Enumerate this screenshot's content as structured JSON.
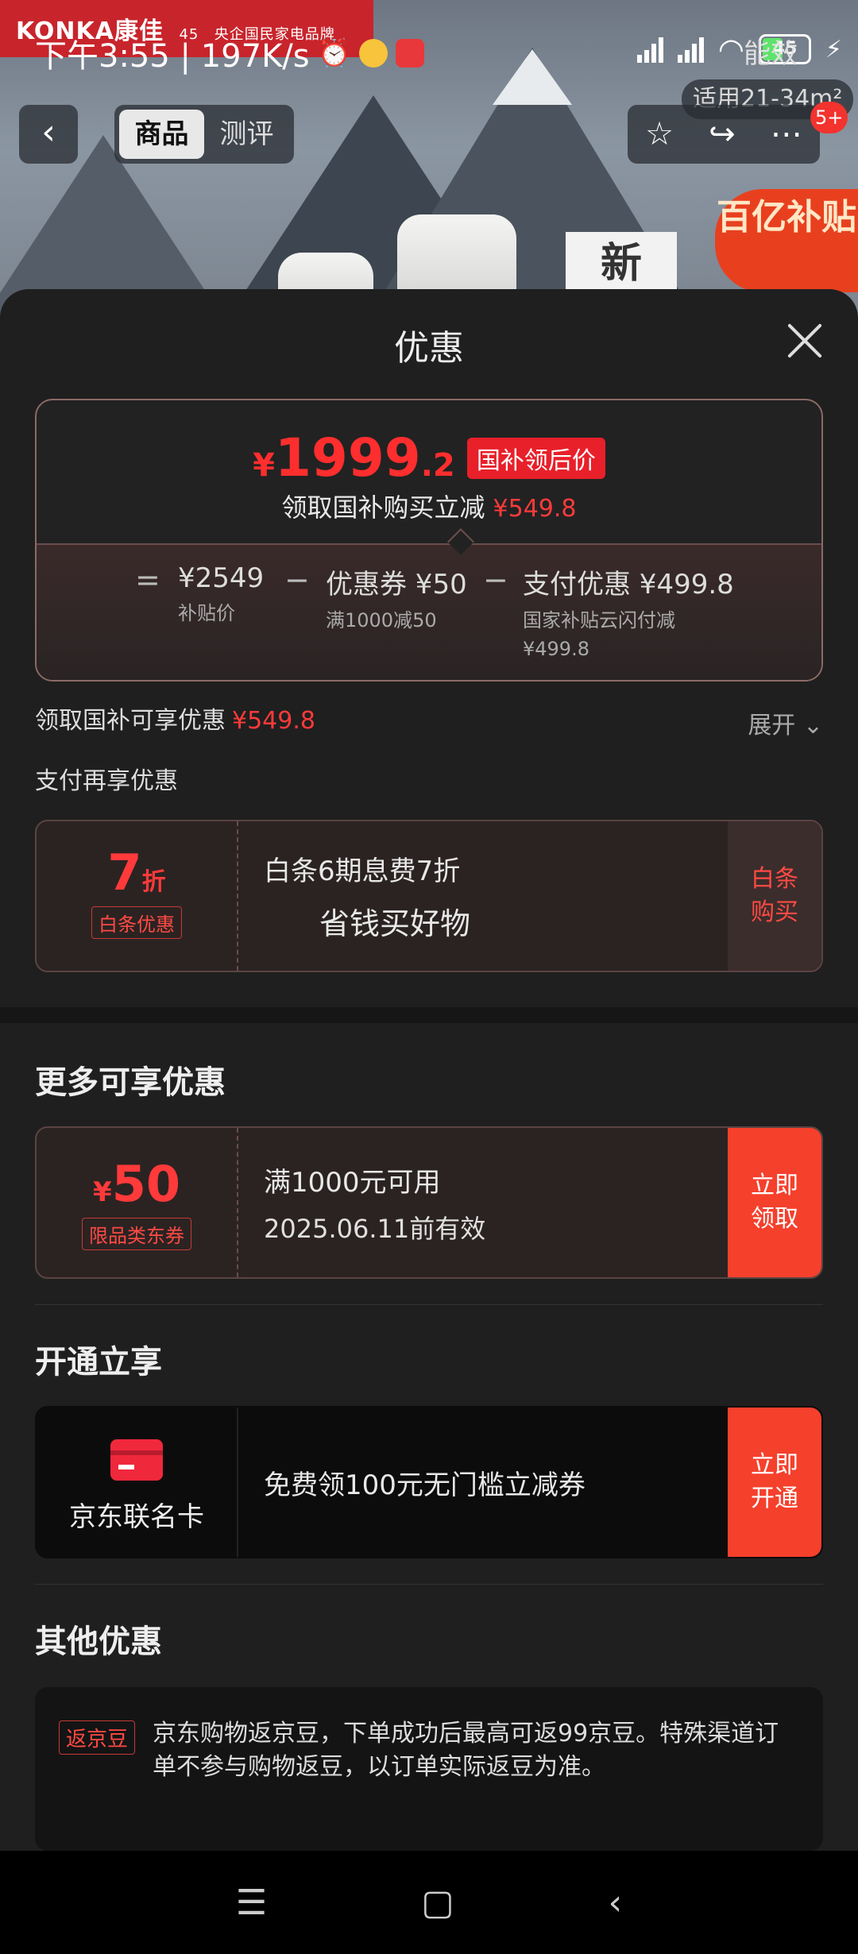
{
  "status_bar": {
    "time_speed": "下午3:55 | 197K/s",
    "battery": "45"
  },
  "background": {
    "brand": "KONKA康佳",
    "brand_sub": "央企国民家电品牌",
    "anniversary": "45",
    "tab_product": "商品",
    "tab_review": "测评",
    "badge_count": "5+",
    "fit_text": "适用21-34m²",
    "top_right_text": "能效",
    "promo_badge": "百亿补贴",
    "new_tag": "新"
  },
  "sheet": {
    "title": "优惠",
    "price": {
      "currency": "¥",
      "main": "1999",
      "decimal": ".2",
      "tag": "国补领后价",
      "sub_label": "领取国补购买立减",
      "sub_value": "¥549.8"
    },
    "breakdown": {
      "eq": "=",
      "subsidy_price": "¥2549",
      "subsidy_price_label": "补贴价",
      "minus1": "−",
      "coupon": "优惠券 ¥50",
      "coupon_label": "满1000减50",
      "minus2": "−",
      "pay": "支付优惠 ¥499.8",
      "pay_label1": "国家补贴云闪付减",
      "pay_label2": "¥499.8"
    },
    "enjoy_row": {
      "label": "领取国补可享优惠",
      "value": "¥549.8",
      "expand": "展开"
    },
    "pay_again_label": "支付再享优惠",
    "baitiao": {
      "discount": "7",
      "discount_unit": "折",
      "tag": "白条优惠",
      "line1": "白条6期息费7折",
      "line2": "省钱买好物",
      "action": "白条购买"
    },
    "more_title": "更多可享优惠",
    "coupon50": {
      "currency": "¥",
      "amount": "50",
      "tag": "限品类东券",
      "line1": "满1000元可用",
      "line2": "2025.06.11前有效",
      "action": "立即领取"
    },
    "open_title": "开通立享",
    "jdcard": {
      "name": "京东联名卡",
      "line1": "免费领100元无门槛立减券",
      "action": "立即开通"
    },
    "other_title": "其他优惠",
    "other": {
      "tag": "返京豆",
      "text": "京东购物返京豆，下单成功后最高可返99京豆。特殊渠道订单不参与购物返豆，以订单实际返豆为准。"
    }
  },
  "colors": {
    "accent_red": "#ff3a3a",
    "button_red": "#f5402c",
    "sheet_bg": "#1f1f1f"
  }
}
